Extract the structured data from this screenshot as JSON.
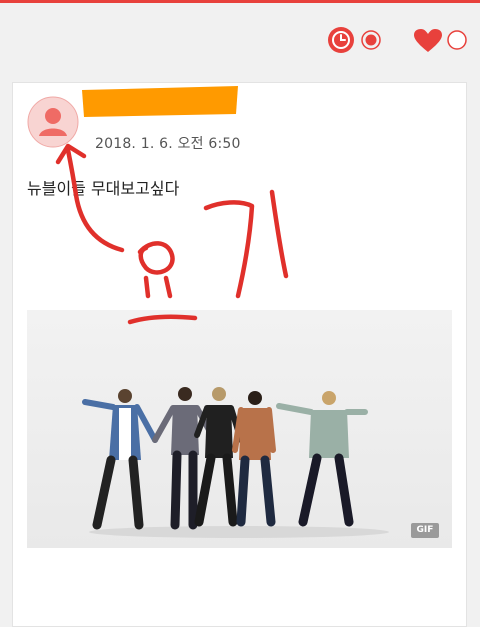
{
  "toolbar": {
    "icons": [
      "clock-icon",
      "radio-icon",
      "heart-icon",
      "radio-icon"
    ],
    "accent_color": "#e8413c"
  },
  "post": {
    "timestamp": "2018. 1. 6. 오전 6:50",
    "text": "뉴블이들 무대보고싶다",
    "media_badge": "GIF",
    "annotation": {
      "text": "요기",
      "color": "#e0302b",
      "icon": "arrow-icon"
    },
    "redaction_color": "#ff9a00"
  }
}
